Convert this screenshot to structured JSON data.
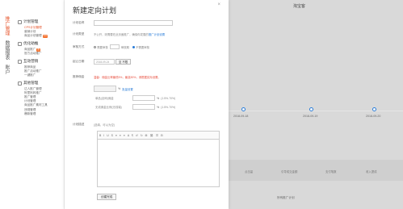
{
  "nav": {
    "vtabs": [
      {
        "label": "推广管理",
        "active": true
      },
      {
        "label": "数据报表",
        "active": false
      },
      {
        "label": "账户",
        "active": false
      }
    ],
    "groups": [
      {
        "head": "计划管理",
        "items": [
          {
            "label": "CPS计划管理",
            "sel": true,
            "tag": ""
          },
          {
            "label": "营销计划",
            "sel": false,
            "tag": ""
          },
          {
            "label": "商品计划管理",
            "sel": false,
            "tag": "new"
          }
        ]
      },
      {
        "head": "优化助推",
        "items": [
          {
            "label": "商品推广",
            "sel": false,
            "tag": "热"
          },
          {
            "label": "官方活动推广",
            "sel": false,
            "tag": ""
          }
        ]
      },
      {
        "head": "互动营销",
        "items": [
          {
            "label": "推荐商品",
            "sel": false,
            "tag": ""
          },
          {
            "label": "推广活动推广",
            "sel": false,
            "tag": ""
          },
          {
            "label": "一键推广",
            "sel": false,
            "tag": ""
          }
        ]
      },
      {
        "head": "其他管理",
        "items": [
          {
            "label": "达人推广管理",
            "sel": false,
            "tag": ""
          },
          {
            "label": "阿里妈妈推广",
            "sel": false,
            "tag": ""
          },
          {
            "label": "推广管理",
            "sel": false,
            "tag": ""
          },
          {
            "label": "计划管理",
            "sel": false,
            "tag": ""
          },
          {
            "label": "商品推广素材工具",
            "sel": false,
            "tag": ""
          },
          {
            "label": "违规管理",
            "sel": false,
            "tag": ""
          },
          {
            "label": "爆款管理",
            "sel": false,
            "tag": ""
          }
        ]
      }
    ]
  },
  "background": {
    "title": "淘宝客",
    "dates": [
      "2018-09-18",
      "2018-09-19",
      "2018-09-20"
    ],
    "columns": [
      "点击量",
      "引导成交金额",
      "支付笔数",
      "收入提成"
    ],
    "footer": "所有推广计划"
  },
  "modal": {
    "title": "新建定向计划",
    "close": "×",
    "plan_name": {
      "label": "计划名称",
      "value": ""
    },
    "plan_type": {
      "label": "计划类型",
      "text": "不公开，则需要在此页面推广，确保你发展的",
      "link": "推广计划设置"
    },
    "audit": {
      "label": "审核方式",
      "options": [
        "需要审核",
        "不需要审核"
      ],
      "selected": 1,
      "extra_label": "审核期"
    },
    "start_time": {
      "label": "起止日期",
      "value": "2018-09-24",
      "btn": "至 不限"
    },
    "commission": {
      "label": "推荐佣金",
      "warn": "温馨：佣金比率最低5%，最高90%，请根据实际设置。",
      "rows": [
        {
          "label": "类目佣金",
          "pct": "%",
          "link": "批量设置",
          "note": ""
        },
        {
          "label": "单品(全网)佣金",
          "pct": "%",
          "link": "",
          "note": "(1.5%-70%)"
        },
        {
          "label": "无线佣金比例(无线端)",
          "pct": "%",
          "link": "",
          "note": "(1.5%-70%)"
        }
      ]
    },
    "description": {
      "label": "计划描述",
      "hint": "(选填，可以为空)"
    },
    "toolbar": [
      "B",
      "I",
      "U",
      "S",
      "≡",
      "≡",
      "≡",
      "A",
      "¶",
      "↺",
      "↻",
      "⊞",
      "⛓",
      "☰",
      "⊟"
    ],
    "save": "创建完成"
  }
}
